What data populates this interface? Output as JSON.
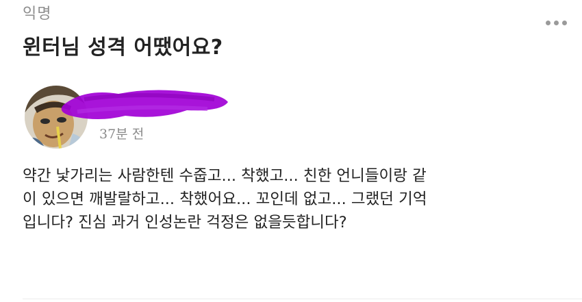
{
  "post": {
    "category": "익명",
    "title": "윈터님 성격 어땠어요?",
    "time": "37분 전",
    "body_lines": [
      "약간 낯가리는 사람한텐 수줍고... 착했고... 친한 언니들이랑 같",
      "이 있으면 깨발랄하고... 착했어요... 꼬인데 없고... 그랬던 기억",
      "입니다? 진심 과거 인성논란 걱정은 없을듯합니다?"
    ]
  },
  "colors": {
    "redaction": "#a100d6",
    "muted_text": "#8e8e8e",
    "title_text": "#222222"
  },
  "icons": {
    "more": "more-options-icon"
  }
}
